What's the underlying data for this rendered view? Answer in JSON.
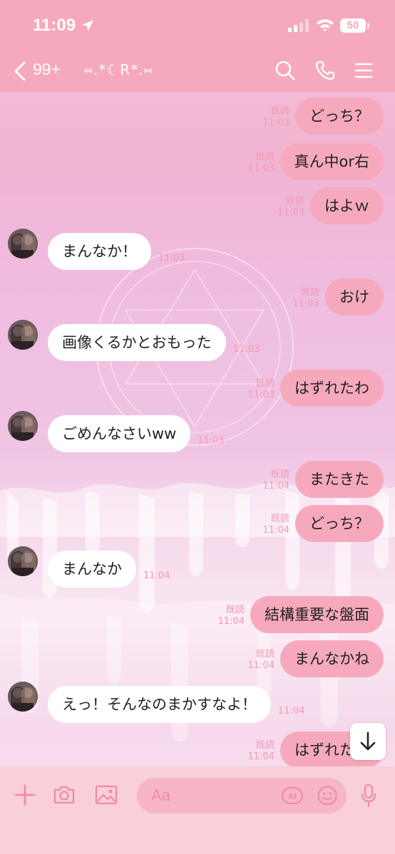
{
  "status_bar": {
    "time": "11:09",
    "battery": "50"
  },
  "header": {
    "back_count": "99+",
    "chat_name": "⑅.*☾R*.⑅"
  },
  "messages": [
    {
      "dir": "out",
      "text": "どっち？",
      "read": "既読",
      "time": "11:03"
    },
    {
      "dir": "out",
      "text": "真ん中or右",
      "read": "既読",
      "time": "11:03"
    },
    {
      "dir": "out",
      "text": "はよｗ",
      "read": "既読",
      "time": "11:03"
    },
    {
      "dir": "in",
      "text": "まんなか！",
      "time": "11:03"
    },
    {
      "dir": "out",
      "text": "おけ",
      "read": "既読",
      "time": "11:03"
    },
    {
      "dir": "in",
      "text": "画像くるかとおもった",
      "time": "11:03"
    },
    {
      "dir": "out",
      "text": "はずれたわ",
      "read": "既読",
      "time": "11:03"
    },
    {
      "dir": "in",
      "text": "ごめんなさいww",
      "time": "11:03"
    },
    {
      "dir": "out",
      "text": "またきた",
      "read": "既読",
      "time": "11:04"
    },
    {
      "dir": "out",
      "text": "どっち？",
      "read": "既読",
      "time": "11:04"
    },
    {
      "dir": "in",
      "text": "まんなか",
      "time": "11:04"
    },
    {
      "dir": "out",
      "text": "結構重要な盤面",
      "read": "既読",
      "time": "11:04"
    },
    {
      "dir": "out",
      "text": "まんなかね",
      "read": "既読",
      "time": "11:04"
    },
    {
      "dir": "in",
      "text": "えっ！そんなのまかすなよ！",
      "time": "11:04"
    },
    {
      "dir": "out",
      "text": "はずれたわ",
      "read": "既読",
      "time": "11:04"
    }
  ],
  "input": {
    "placeholder": "Aa"
  },
  "icons": {
    "back": "chevron-left-icon",
    "search": "search-icon",
    "call": "phone-icon",
    "menu": "menu-icon",
    "add": "plus-icon",
    "camera": "camera-icon",
    "image": "image-icon",
    "ai": "ai-icon",
    "emoji": "emoji-icon",
    "mic": "mic-icon",
    "scroll": "arrow-down-icon"
  },
  "colors": {
    "accent": "#f6a9bd",
    "bubble_out": "#f6a9bd",
    "bubble_in": "#ffffff",
    "meta": "#f39ab3"
  }
}
